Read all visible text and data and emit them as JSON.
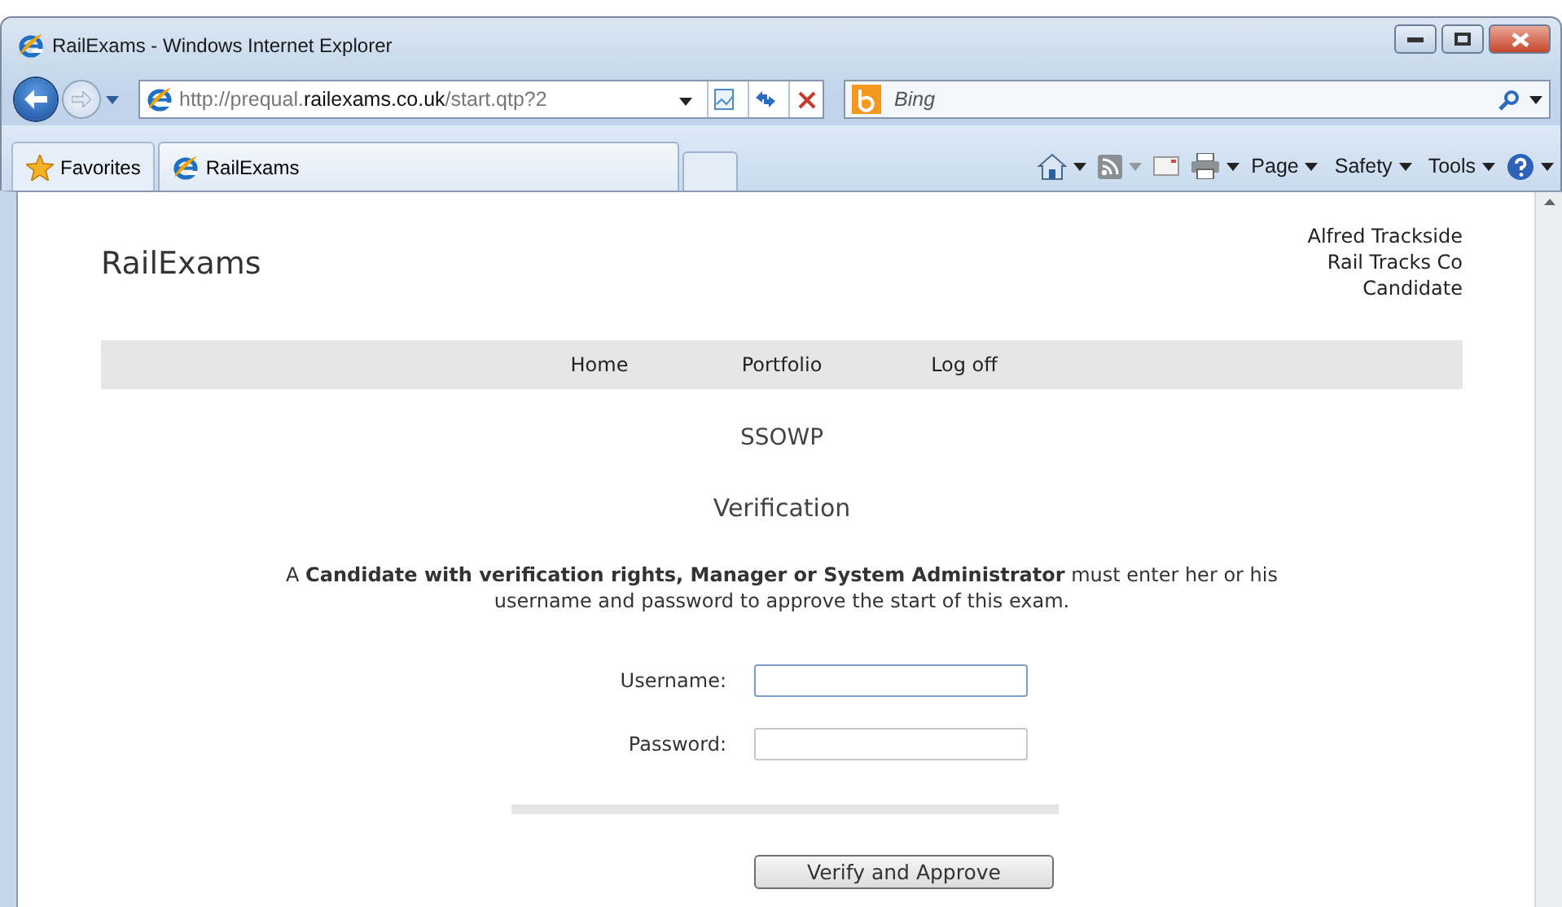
{
  "window": {
    "title": "RailExams - Windows Internet Explorer"
  },
  "address_bar": {
    "url": "http://prequal.**railexams.co.uk**/start.qtp?2"
  },
  "search": {
    "placeholder": "Bing"
  },
  "favorites": {
    "label": "Favorites"
  },
  "tabs": [
    {
      "label": "RailExams",
      "selected": true
    }
  ],
  "command_bar": [
    {
      "label": "Page"
    },
    {
      "label": "Safety"
    },
    {
      "label": "Tools"
    }
  ],
  "page": {
    "logo": "RailExams",
    "user": [
      "Alfred Trackside",
      "Rail Tracks Co",
      "Candidate"
    ],
    "nav": [
      "Home",
      "Portfolio",
      "Log off"
    ],
    "heading": "SSOWP",
    "subheading": "Verification",
    "instructions": "A **Candidate with verification rights, Manager or System Administrator** must enter her or his username and password to approve the start of this exam.",
    "fields": [
      {
        "label": "Username:",
        "focused": true
      },
      {
        "label": "Password:",
        "focused": false
      }
    ],
    "submit": "Verify and Approve"
  }
}
